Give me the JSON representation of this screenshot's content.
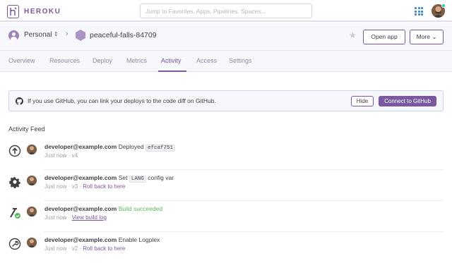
{
  "header": {
    "brand": "HEROKU",
    "search_placeholder": "Jump to Favorites, Apps, Pipelines, Spaces...",
    "accent_color": "#79589f"
  },
  "app_header": {
    "account": "Personal",
    "app_name": "peaceful-falls-84709",
    "open_app_label": "Open app",
    "more_label": "More"
  },
  "tabs": [
    {
      "label": "Overview"
    },
    {
      "label": "Resources"
    },
    {
      "label": "Deploy"
    },
    {
      "label": "Metrics"
    },
    {
      "label": "Activity",
      "active": true
    },
    {
      "label": "Access"
    },
    {
      "label": "Settings"
    }
  ],
  "banner": {
    "text": "If you use GitHub, you can link your deploys to the code diff on GitHub.",
    "hide_label": "Hide",
    "connect_label": "Connect to GitHub"
  },
  "feed": {
    "title": "Activity Feed",
    "items": [
      {
        "icon": "deploy-icon",
        "user": "developer@example.com",
        "action": "Deployed",
        "code": "efcaf751",
        "suffix": "",
        "time": "Just now",
        "version": "v4",
        "link": ""
      },
      {
        "icon": "gear-icon",
        "user": "developer@example.com",
        "action": "Set",
        "code": "LANG",
        "suffix": "config var",
        "time": "Just now",
        "version": "v3",
        "link": "Roll back to here"
      },
      {
        "icon": "build-icon",
        "user": "developer@example.com",
        "action": "Build succeeded",
        "code": "",
        "suffix": "",
        "time": "Just now",
        "version": "",
        "link": "View build log"
      },
      {
        "icon": "wrench-icon",
        "user": "developer@example.com",
        "action": "Enable Logplex",
        "code": "",
        "suffix": "",
        "time": "Just now",
        "version": "v2",
        "link": "Roll back to here"
      }
    ]
  }
}
